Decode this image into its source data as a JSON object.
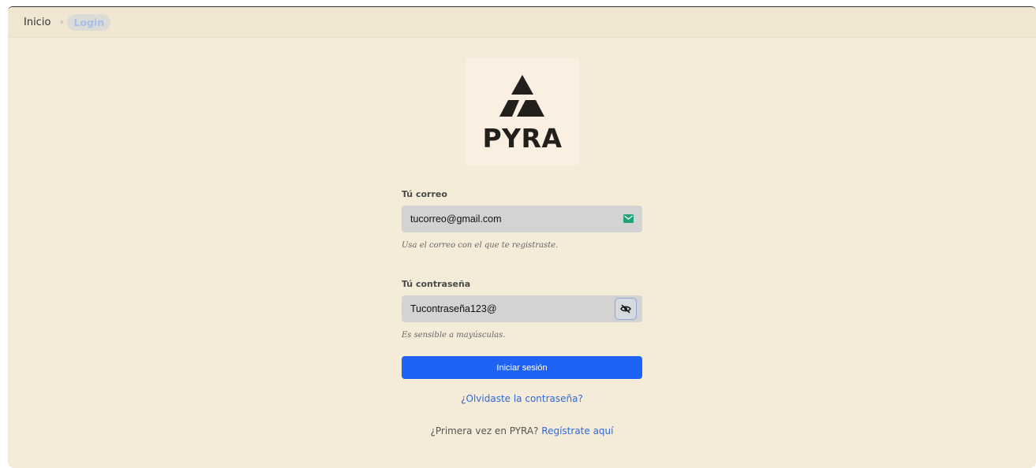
{
  "breadcrumb": {
    "home": "Inicio",
    "separator": "›",
    "current": "Login"
  },
  "logo": {
    "text": "PYRA",
    "icon": "pyramid-logo-icon"
  },
  "form": {
    "email": {
      "label": "Tú correo",
      "value": "tucorreo@gmail.com",
      "hint": "Usa el correo con el que te registraste.",
      "icon": "mail-icon"
    },
    "password": {
      "label": "Tú contraseña",
      "value": "Tucontraseña123@",
      "hint": "Es sensible a mayúsculas.",
      "icon": "eye-slash-icon"
    },
    "submit_label": "Iniciar sesión",
    "forgot_label": "¿Olvidaste la contraseña?",
    "register_prompt": "¿Primera vez en PYRA?",
    "register_link": "Regístrate aquí"
  },
  "colors": {
    "background": "#f5ebd9",
    "primary": "#1f63f6",
    "link": "#2f6ad9",
    "input_bg": "#d3d3d3"
  }
}
